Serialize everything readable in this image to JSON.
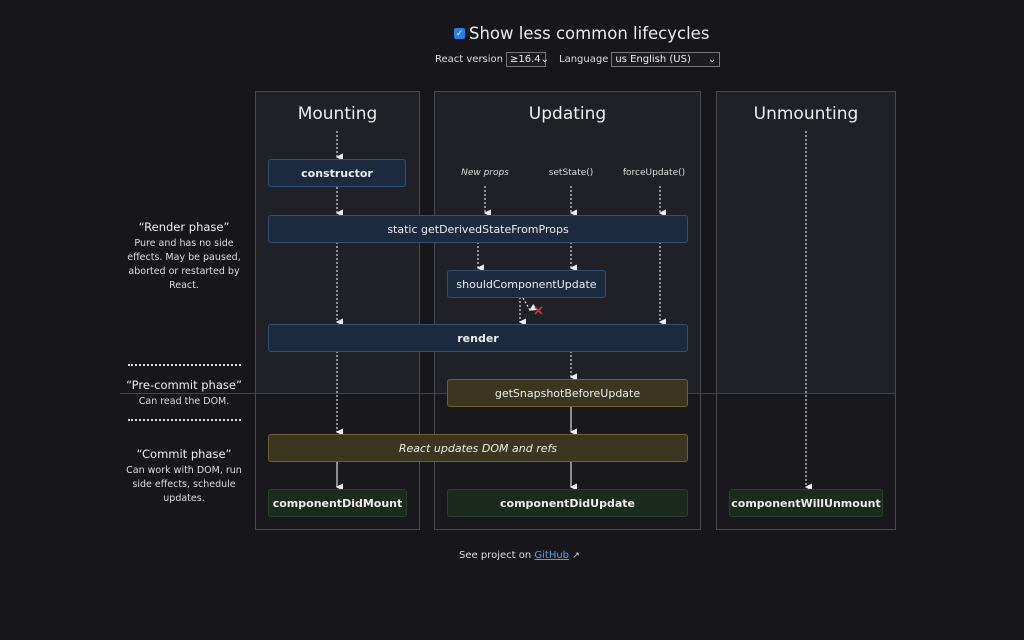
{
  "header": {
    "show_less_common_label": "Show less common lifecycles",
    "show_less_common_checked": true,
    "react_version_label": "React version",
    "react_version_value": "≥16.4",
    "language_label": "Language",
    "language_value": "us English (US)"
  },
  "columns": {
    "mounting": "Mounting",
    "updating": "Updating",
    "unmounting": "Unmounting"
  },
  "phases": {
    "render": {
      "title": "“Render phase”",
      "desc": "Pure and has no side effects. May be paused, aborted or restarted by React."
    },
    "precommit": {
      "title": "“Pre-commit phase”",
      "desc": "Can read the DOM."
    },
    "commit": {
      "title": "“Commit phase”",
      "desc": "Can work with DOM, run side effects, schedule updates."
    }
  },
  "triggers": {
    "new_props": "New props",
    "set_state": "setState()",
    "force_update": "forceUpdate()"
  },
  "methods": {
    "constructor": "constructor",
    "gdsfp": "static getDerivedStateFromProps",
    "scu": "shouldComponentUpdate",
    "render": "render",
    "gsbu": "getSnapshotBeforeUpdate",
    "dom_update": "React updates DOM and refs",
    "cdm": "componentDidMount",
    "cdu": "componentDidUpdate",
    "cwu": "componentWillUnmount"
  },
  "footer": {
    "text": "See project on",
    "link": "GitHub"
  },
  "colors": {
    "render_phase": "#1c2a40",
    "precommit": "#3c3620",
    "commit": "#1b2a1d",
    "link": "#4aa3e8",
    "cancel_x": "#e03030"
  }
}
